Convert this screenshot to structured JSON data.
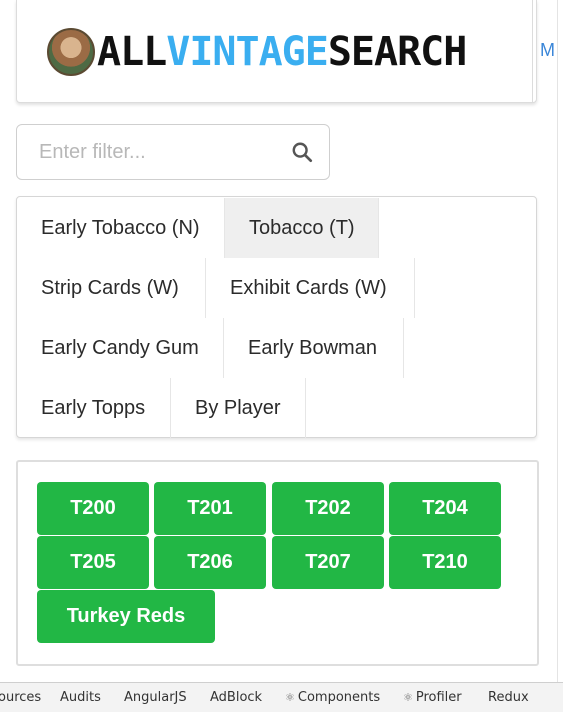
{
  "header": {
    "logo_parts": {
      "all": "ALL",
      "vintage": "VINTAGE",
      "search": "SEARCH"
    },
    "menu_peek": "M",
    "logo_accent_color": "#3aaef0"
  },
  "filter": {
    "placeholder": "Enter filter...",
    "value": ""
  },
  "categories": {
    "items": [
      {
        "label": "Early Tobacco (N)",
        "active": false
      },
      {
        "label": "Tobacco (T)",
        "active": true
      },
      {
        "label": "Strip Cards (W)",
        "active": false
      },
      {
        "label": "Exhibit Cards (W)",
        "active": false
      },
      {
        "label": "Early Candy Gum",
        "active": false
      },
      {
        "label": "Early Bowman",
        "active": false
      },
      {
        "label": "Early Topps",
        "active": false
      },
      {
        "label": "By Player",
        "active": false
      }
    ]
  },
  "sets": {
    "color": "#22b745",
    "items": [
      "T200",
      "T201",
      "T202",
      "T204",
      "T205",
      "T206",
      "T207",
      "T210",
      "Turkey Reds"
    ]
  },
  "devtools": {
    "tabs": [
      {
        "label": "ources",
        "icon": ""
      },
      {
        "label": "Audits",
        "icon": ""
      },
      {
        "label": "AngularJS",
        "icon": ""
      },
      {
        "label": "AdBlock",
        "icon": ""
      },
      {
        "label": "Components",
        "icon": "react-icon"
      },
      {
        "label": "Profiler",
        "icon": "react-icon"
      },
      {
        "label": "Redux",
        "icon": ""
      }
    ]
  }
}
